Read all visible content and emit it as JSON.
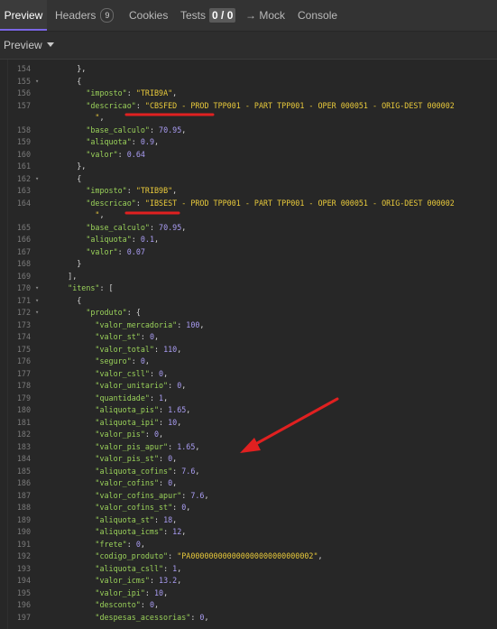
{
  "tabs": {
    "preview": "Preview",
    "headers": "Headers",
    "headers_count": "9",
    "cookies": "Cookies",
    "tests": "Tests",
    "tests_count": "0 / 0",
    "mock": "→ Mock",
    "console": "Console"
  },
  "preview_mode": "Preview",
  "colors": {
    "accent": "#7b66e6",
    "annotation": "#e02020",
    "key": "#9ad15a",
    "string": "#e8c93b",
    "number": "#a99cf2"
  },
  "code": [
    {
      "ln": "154",
      "fold": "",
      "indent": "      ",
      "key": "",
      "op": "},",
      "value": "",
      "vtype": ""
    },
    {
      "ln": "155",
      "fold": "▾",
      "indent": "      ",
      "key": "",
      "op": "{",
      "value": "",
      "vtype": ""
    },
    {
      "ln": "156",
      "fold": "",
      "indent": "        ",
      "key": "\"imposto\"",
      "op": ": ",
      "value": "\"TRIB9A\"",
      "vtype": "s",
      "tail": ","
    },
    {
      "ln": "157",
      "fold": "",
      "indent": "        ",
      "key": "\"descricao\"",
      "op": ": ",
      "value": "\"CBSFED - PROD TPP001 - PART TPP001 - OPER 000051 - ORIG-DEST 000002",
      "vtype": "s",
      "tail": ""
    },
    {
      "ln": "",
      "fold": "",
      "indent": "          ",
      "key": "",
      "op": "",
      "value": "\"",
      "vtype": "s",
      "tail": ","
    },
    {
      "ln": "158",
      "fold": "",
      "indent": "        ",
      "key": "\"base_calculo\"",
      "op": ": ",
      "value": "70.95",
      "vtype": "n",
      "tail": ","
    },
    {
      "ln": "159",
      "fold": "",
      "indent": "        ",
      "key": "\"aliquota\"",
      "op": ": ",
      "value": "0.9",
      "vtype": "n",
      "tail": ","
    },
    {
      "ln": "160",
      "fold": "",
      "indent": "        ",
      "key": "\"valor\"",
      "op": ": ",
      "value": "0.64",
      "vtype": "n",
      "tail": ""
    },
    {
      "ln": "161",
      "fold": "",
      "indent": "      ",
      "key": "",
      "op": "},",
      "value": "",
      "vtype": ""
    },
    {
      "ln": "162",
      "fold": "▾",
      "indent": "      ",
      "key": "",
      "op": "{",
      "value": "",
      "vtype": ""
    },
    {
      "ln": "163",
      "fold": "",
      "indent": "        ",
      "key": "\"imposto\"",
      "op": ": ",
      "value": "\"TRIB9B\"",
      "vtype": "s",
      "tail": ","
    },
    {
      "ln": "164",
      "fold": "",
      "indent": "        ",
      "key": "\"descricao\"",
      "op": ": ",
      "value": "\"IBSEST - PROD TPP001 - PART TPP001 - OPER 000051 - ORIG-DEST 000002",
      "vtype": "s",
      "tail": ""
    },
    {
      "ln": "",
      "fold": "",
      "indent": "          ",
      "key": "",
      "op": "",
      "value": "\"",
      "vtype": "s",
      "tail": ","
    },
    {
      "ln": "165",
      "fold": "",
      "indent": "        ",
      "key": "\"base_calculo\"",
      "op": ": ",
      "value": "70.95",
      "vtype": "n",
      "tail": ","
    },
    {
      "ln": "166",
      "fold": "",
      "indent": "        ",
      "key": "\"aliquota\"",
      "op": ": ",
      "value": "0.1",
      "vtype": "n",
      "tail": ","
    },
    {
      "ln": "167",
      "fold": "",
      "indent": "        ",
      "key": "\"valor\"",
      "op": ": ",
      "value": "0.07",
      "vtype": "n",
      "tail": ""
    },
    {
      "ln": "168",
      "fold": "",
      "indent": "      ",
      "key": "",
      "op": "}",
      "value": "",
      "vtype": ""
    },
    {
      "ln": "169",
      "fold": "",
      "indent": "    ",
      "key": "",
      "op": "],",
      "value": "",
      "vtype": ""
    },
    {
      "ln": "170",
      "fold": "▾",
      "indent": "    ",
      "key": "\"itens\"",
      "op": ": [",
      "value": "",
      "vtype": ""
    },
    {
      "ln": "171",
      "fold": "▾",
      "indent": "      ",
      "key": "",
      "op": "{",
      "value": "",
      "vtype": ""
    },
    {
      "ln": "172",
      "fold": "▾",
      "indent": "        ",
      "key": "\"produto\"",
      "op": ": {",
      "value": "",
      "vtype": ""
    },
    {
      "ln": "173",
      "fold": "",
      "indent": "          ",
      "key": "\"valor_mercadoria\"",
      "op": ": ",
      "value": "100",
      "vtype": "n",
      "tail": ","
    },
    {
      "ln": "174",
      "fold": "",
      "indent": "          ",
      "key": "\"valor_st\"",
      "op": ": ",
      "value": "0",
      "vtype": "n",
      "tail": ","
    },
    {
      "ln": "175",
      "fold": "",
      "indent": "          ",
      "key": "\"valor_total\"",
      "op": ": ",
      "value": "110",
      "vtype": "n",
      "tail": ","
    },
    {
      "ln": "176",
      "fold": "",
      "indent": "          ",
      "key": "\"seguro\"",
      "op": ": ",
      "value": "0",
      "vtype": "n",
      "tail": ","
    },
    {
      "ln": "177",
      "fold": "",
      "indent": "          ",
      "key": "\"valor_csll\"",
      "op": ": ",
      "value": "0",
      "vtype": "n",
      "tail": ","
    },
    {
      "ln": "178",
      "fold": "",
      "indent": "          ",
      "key": "\"valor_unitario\"",
      "op": ": ",
      "value": "0",
      "vtype": "n",
      "tail": ","
    },
    {
      "ln": "179",
      "fold": "",
      "indent": "          ",
      "key": "\"quantidade\"",
      "op": ": ",
      "value": "1",
      "vtype": "n",
      "tail": ","
    },
    {
      "ln": "180",
      "fold": "",
      "indent": "          ",
      "key": "\"aliquota_pis\"",
      "op": ": ",
      "value": "1.65",
      "vtype": "n",
      "tail": ","
    },
    {
      "ln": "181",
      "fold": "",
      "indent": "          ",
      "key": "\"aliquota_ipi\"",
      "op": ": ",
      "value": "10",
      "vtype": "n",
      "tail": ","
    },
    {
      "ln": "182",
      "fold": "",
      "indent": "          ",
      "key": "\"valor_pis\"",
      "op": ": ",
      "value": "0",
      "vtype": "n",
      "tail": ","
    },
    {
      "ln": "183",
      "fold": "",
      "indent": "          ",
      "key": "\"valor_pis_apur\"",
      "op": ": ",
      "value": "1.65",
      "vtype": "n",
      "tail": ","
    },
    {
      "ln": "184",
      "fold": "",
      "indent": "          ",
      "key": "\"valor_pis_st\"",
      "op": ": ",
      "value": "0",
      "vtype": "n",
      "tail": ","
    },
    {
      "ln": "185",
      "fold": "",
      "indent": "          ",
      "key": "\"aliquota_cofins\"",
      "op": ": ",
      "value": "7.6",
      "vtype": "n",
      "tail": ","
    },
    {
      "ln": "186",
      "fold": "",
      "indent": "          ",
      "key": "\"valor_cofins\"",
      "op": ": ",
      "value": "0",
      "vtype": "n",
      "tail": ","
    },
    {
      "ln": "187",
      "fold": "",
      "indent": "          ",
      "key": "\"valor_cofins_apur\"",
      "op": ": ",
      "value": "7.6",
      "vtype": "n",
      "tail": ","
    },
    {
      "ln": "188",
      "fold": "",
      "indent": "          ",
      "key": "\"valor_cofins_st\"",
      "op": ": ",
      "value": "0",
      "vtype": "n",
      "tail": ","
    },
    {
      "ln": "189",
      "fold": "",
      "indent": "          ",
      "key": "\"aliquota_st\"",
      "op": ": ",
      "value": "18",
      "vtype": "n",
      "tail": ","
    },
    {
      "ln": "190",
      "fold": "",
      "indent": "          ",
      "key": "\"aliquota_icms\"",
      "op": ": ",
      "value": "12",
      "vtype": "n",
      "tail": ","
    },
    {
      "ln": "191",
      "fold": "",
      "indent": "          ",
      "key": "\"frete\"",
      "op": ": ",
      "value": "0",
      "vtype": "n",
      "tail": ","
    },
    {
      "ln": "192",
      "fold": "",
      "indent": "          ",
      "key": "\"codigo_produto\"",
      "op": ": ",
      "value": "\"PA000000000000000000000000002\"",
      "vtype": "s",
      "tail": ","
    },
    {
      "ln": "193",
      "fold": "",
      "indent": "          ",
      "key": "\"aliquota_csll\"",
      "op": ": ",
      "value": "1",
      "vtype": "n",
      "tail": ","
    },
    {
      "ln": "194",
      "fold": "",
      "indent": "          ",
      "key": "\"valor_icms\"",
      "op": ": ",
      "value": "13.2",
      "vtype": "n",
      "tail": ","
    },
    {
      "ln": "195",
      "fold": "",
      "indent": "          ",
      "key": "\"valor_ipi\"",
      "op": ": ",
      "value": "10",
      "vtype": "n",
      "tail": ","
    },
    {
      "ln": "196",
      "fold": "",
      "indent": "          ",
      "key": "\"desconto\"",
      "op": ": ",
      "value": "0",
      "vtype": "n",
      "tail": ","
    },
    {
      "ln": "197",
      "fold": "",
      "indent": "          ",
      "key": "\"despesas_acessorias\"",
      "op": ": ",
      "value": "0",
      "vtype": "n",
      "tail": ","
    }
  ]
}
